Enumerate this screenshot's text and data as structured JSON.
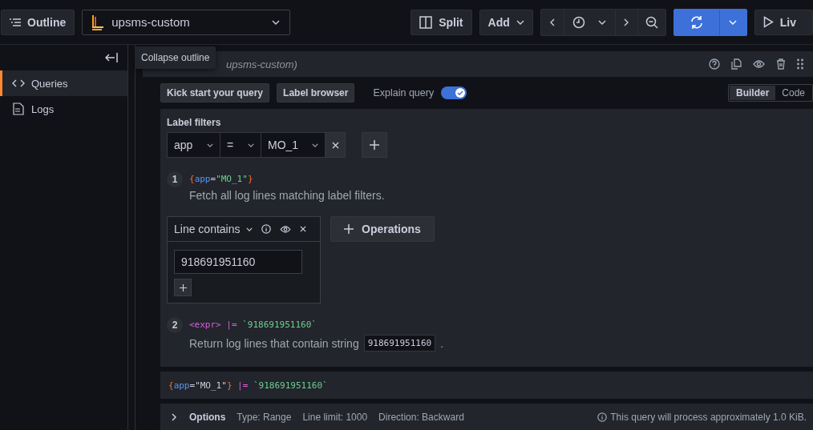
{
  "toolbar": {
    "outline_button": "Outline",
    "datasource": "upsms-custom",
    "split_button": "Split",
    "add_button": "Add",
    "live_button": "Liv"
  },
  "sidebar": {
    "tooltip": "Collapse outline",
    "items": [
      {
        "label": "Queries",
        "selected": true,
        "kind": "code"
      },
      {
        "label": "Logs",
        "selected": false,
        "kind": "logs"
      }
    ]
  },
  "query": {
    "header": "upsms-custom)",
    "kick_start_button": "Kick start your query",
    "label_browser_button": "Label browser",
    "explain_query": {
      "label": "Explain query",
      "on": true
    },
    "modes": [
      {
        "label": "Builder",
        "selected": true
      },
      {
        "label": "Code",
        "selected": false
      }
    ],
    "label_filters": {
      "title": "Label filters",
      "filters": [
        {
          "label": "app",
          "operator": "=",
          "value": "MO_1"
        }
      ]
    },
    "steps": [
      {
        "number": "1",
        "expression": [
          {
            "text": "{",
            "kind": "brace"
          },
          {
            "text": "app",
            "kind": "label"
          },
          {
            "text": "=",
            "kind": "op"
          },
          {
            "text": "\"MO_1\"",
            "kind": "string"
          },
          {
            "text": "}",
            "kind": "brace"
          }
        ],
        "description": "Fetch all log lines matching label filters."
      },
      {
        "number": "2",
        "expression": [
          {
            "text": "<expr>",
            "kind": "placeholder"
          },
          {
            "text": " |= ",
            "kind": "pipe"
          },
          {
            "text": "`918691951160`",
            "kind": "string"
          }
        ],
        "description": "Return log lines that contain string",
        "code": "918691951160",
        "suffix": "."
      }
    ],
    "operation": {
      "title": "Line contains",
      "value": "918691951160"
    },
    "operations_button": "Operations",
    "preview": [
      {
        "text": "{",
        "kind": "brace"
      },
      {
        "text": "app",
        "kind": "label"
      },
      {
        "text": "=",
        "kind": "op"
      },
      {
        "text": "\"MO_1\"",
        "kind": "op"
      },
      {
        "text": "}",
        "kind": "brace"
      },
      {
        "text": " |= ",
        "kind": "pipe"
      },
      {
        "text": "`918691951160`",
        "kind": "string"
      }
    ],
    "options": {
      "title": "Options",
      "items": [
        "Type: Range",
        "Line limit: 1000",
        "Direction: Backward"
      ],
      "estimate": "This query will process approximately 1.0 KiB."
    }
  }
}
